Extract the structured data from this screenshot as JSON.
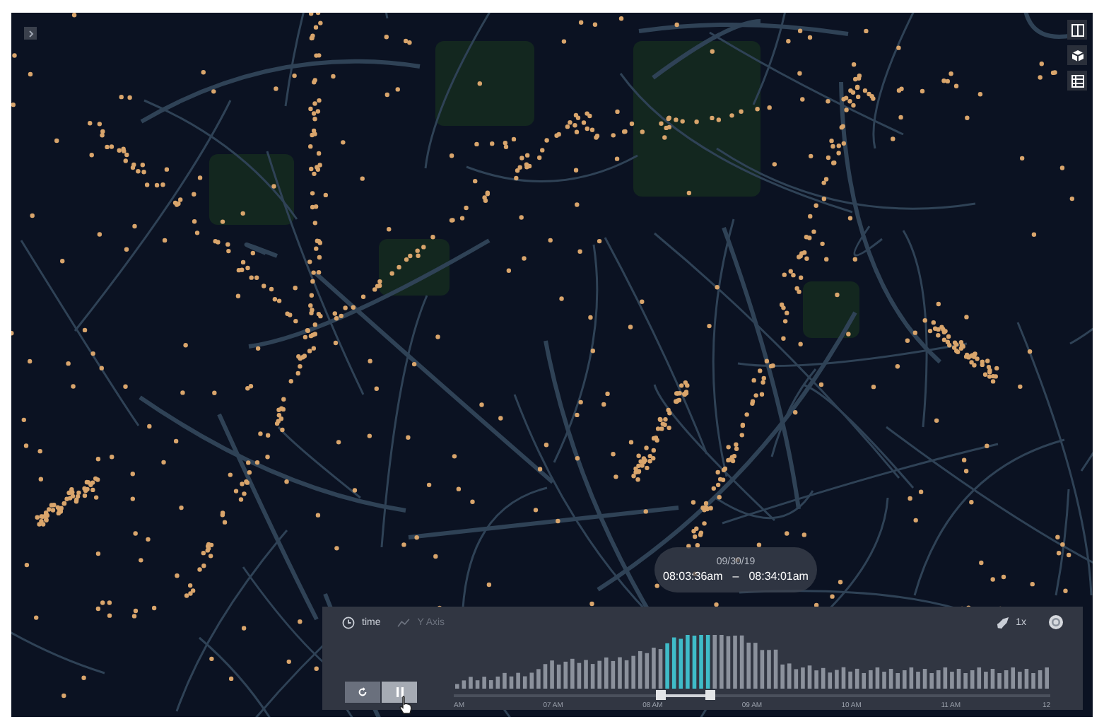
{
  "timestamp": {
    "date": "09/30/19",
    "start": "08:03:36am",
    "separator": "–",
    "end": "08:34:01am"
  },
  "timeline": {
    "field": "time",
    "y_axis": "Y Axis",
    "y_axis_disabled": true,
    "speed": "1x",
    "playing": true,
    "handles": [
      {
        "level": 0.347
      },
      {
        "level": 0.43
      }
    ],
    "ticks": [
      "AM",
      "07 AM",
      "08 AM",
      "09 AM",
      "10 AM",
      "11 AM",
      "12"
    ]
  }
}
